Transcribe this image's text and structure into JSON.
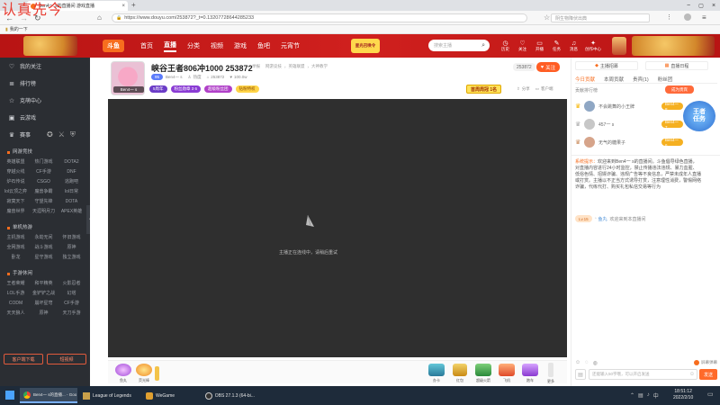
{
  "watermark": "认真先今",
  "browser": {
    "tabs": [
      {
        "label": "Ben4一 s的直播间 游戏直播"
      },
      {
        "label": ""
      }
    ],
    "url": "https://www.douyu.com/253872?_t=0.13207728644285233",
    "search_placeholder": "阴生物降伏出典",
    "bookmark": "我的一下"
  },
  "site": {
    "logo": "斗鱼",
    "nav": [
      "首页",
      "直播",
      "分类",
      "视频",
      "游戏",
      "鱼吧",
      "元宵节"
    ],
    "search_placeholder": "搜索主播",
    "promo": "星光召唤令",
    "user_icons": [
      "历史",
      "关注",
      "开播",
      "任务",
      "消息",
      "创作中心"
    ]
  },
  "sidebar": {
    "items": [
      {
        "label": "我的关注",
        "icon": "heart-icon"
      },
      {
        "label": "排行榜",
        "icon": "list-icon"
      },
      {
        "label": "克萌中心",
        "icon": "star-icon"
      },
      {
        "label": "云游戏",
        "icon": "gamepad-icon"
      },
      {
        "label": "赛事",
        "icon": "trophy-icon"
      }
    ],
    "sections": [
      {
        "title": "网游竞技",
        "items": [
          "英雄联盟",
          "热门游戏",
          "DOTA2",
          "穿越火线",
          "CF手游",
          "DNF",
          "炉石传说",
          "CSGO",
          "逃跑吧",
          "lol云顶之弈",
          "魔兽争霸",
          "lol日常",
          "寂寞天下",
          "守望先锋",
          "DOTA",
          "魔兽世界",
          "天涯明月刀",
          "APEX英雄"
        ]
      },
      {
        "title": "单机热游",
        "items": [
          "主机游戏",
          "永劫无间",
          "怀旧游戏",
          "全网游戏",
          "战斗游戏",
          "原神",
          "卧龙",
          "星守游戏",
          "独立游戏"
        ]
      },
      {
        "title": "手游休闲",
        "items": [
          "王者荣耀",
          "和平精英",
          "火影忍者",
          "LOL手游",
          "金铲铲之战",
          "幻塔",
          "CODM",
          "崩坏星穹",
          "CF手游",
          "天天狼人",
          "原神",
          "天刀手游"
        ]
      }
    ],
    "bottom_buttons": [
      "客户端下载",
      "短视频"
    ]
  },
  "room": {
    "streamer": "Ben4一 s",
    "title": "峡谷王者806冲1000 253872",
    "tags": [
      "举报",
      "网游竞技",
      "英雄联盟",
      "大神教学"
    ],
    "level": "95",
    "hot_label": "热度",
    "room_id": "253872",
    "followers": "100.0w",
    "follow_label": "关注",
    "badges": [
      "5周年",
      "粉丝勋章 3 6",
      "超级粉丝团",
      "钻粉特权"
    ],
    "right_badge": "首周周冠 1名",
    "actions": [
      "分享",
      "客户端"
    ],
    "loading_text": "主播正在连线中，请稍后重试"
  },
  "gifts": [
    "鱼丸",
    "荧光棒",
    "办卡",
    "红包",
    "超级火箭",
    "飞机",
    "跑车",
    "更多"
  ],
  "rightpanel": {
    "contribute_tabs": [
      "主播招募",
      "直播日程"
    ],
    "rank_tabs": [
      "今日贡献",
      "本周贡献",
      "贵宾(1)",
      "粉丝团"
    ],
    "rank_label": "贡献排行榜",
    "enter_label": "成为贵宾",
    "ranks": [
      {
        "name": "不会跳舞的小王牌",
        "badge": "Ben4一 8"
      },
      {
        "name": "457一 s",
        "badge": "Ben4一 7"
      },
      {
        "name": "无气的糖果子",
        "badge": "Ben4一 6"
      }
    ],
    "promo_text": "王者任务",
    "system_tag": "系统提示：",
    "system_msg": "欢迎来到Ben4一 s的直播间。斗鱼倡导绿色直播，对直播内容进行24小时监控，禁止传播违法违规、暴力血腥、低俗色情、招嫖诈骗、违规广告等不良信息，严禁未成年人直播或打赏。主播以不正当方式诱导打赏，注意理性消费，警惕网络诈骗，代练代打、购买礼包私信交易等行为",
    "welcome_user": "鱼丸",
    "welcome_msg": "欢迎来到本直播间",
    "level_tag": "Lv.15",
    "send_label": "发送",
    "report_label": "屏幕弹幕",
    "input_placeholder": "还能输入50字哦，可以开启发送",
    "extra_buttons": [
      "粉丝",
      "贵宾"
    ]
  },
  "taskbar": {
    "apps": [
      "Ben4一 s的直播... - Google Chrome",
      "League of Legends",
      "WeGame",
      "OBS 27.1.3 (64-bi..."
    ],
    "time": "18:51:12",
    "date": "2022/2/10"
  }
}
